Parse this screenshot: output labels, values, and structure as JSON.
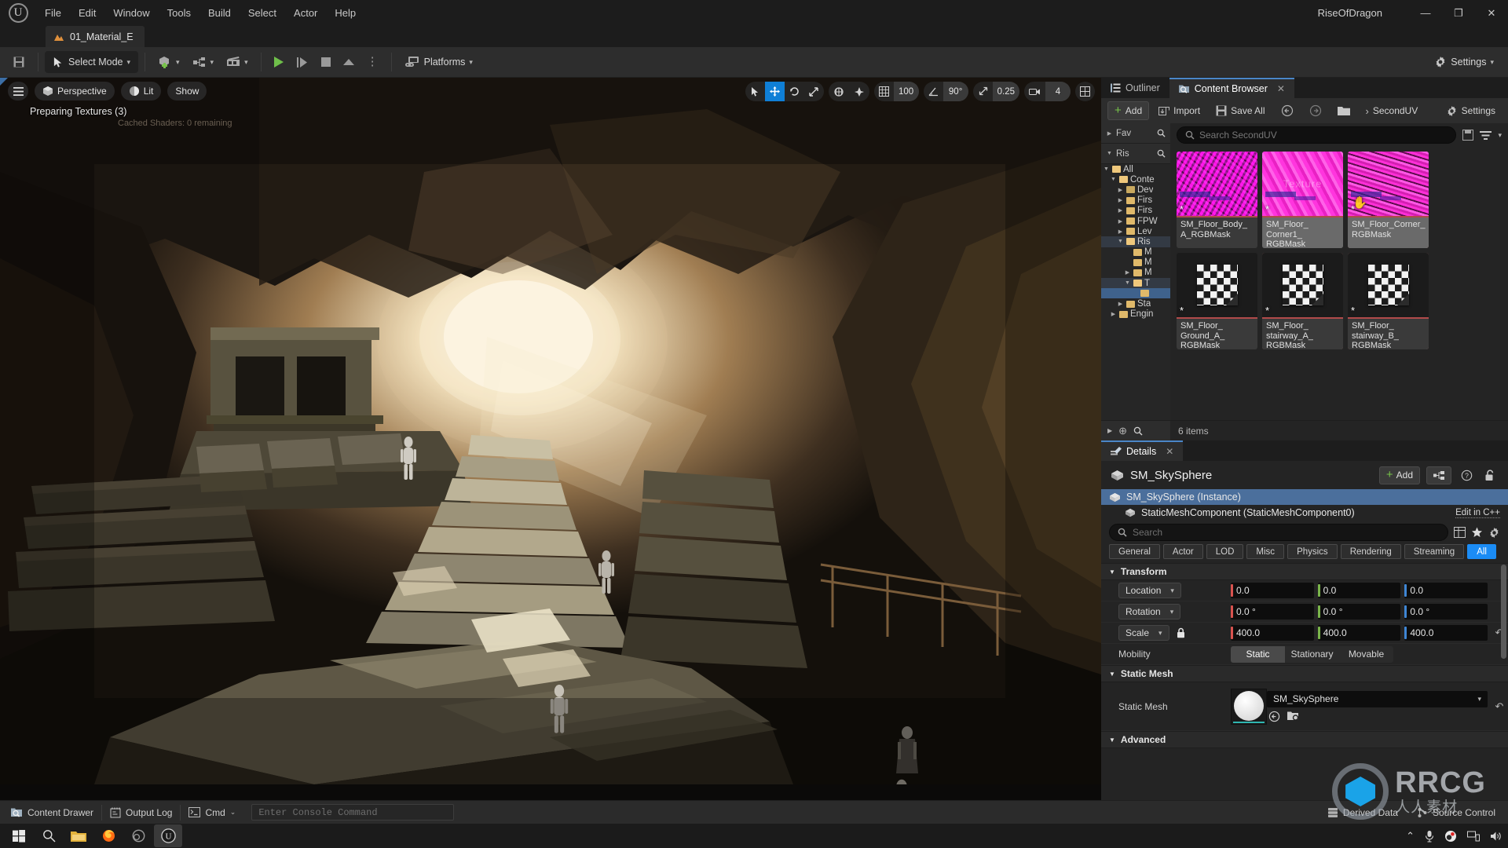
{
  "titlebar": {
    "logo_icon": "unreal-engine-logo",
    "menu": [
      "File",
      "Edit",
      "Window",
      "Tools",
      "Build",
      "Select",
      "Actor",
      "Help"
    ],
    "project_name": "RiseOfDragon",
    "window_controls": {
      "minimize": "—",
      "maximize": "❐",
      "close": "✕"
    }
  },
  "level_tab": {
    "label": "01_Material_E",
    "icon": "level-icon"
  },
  "toolbar": {
    "save_icon": "save-icon",
    "mode_label": "Select Mode",
    "mode_icon": "select-mode-icon",
    "add_icon": "add-actor-icon",
    "blueprint_icon": "blueprints-icon",
    "cinematics_icon": "cinematics-icon",
    "play_icon": "play-icon",
    "skip_icon": "skip-icon",
    "stop_icon": "stop-icon",
    "eject_icon": "eject-icon",
    "more_icon": "kebab-icon",
    "platforms_label": "Platforms",
    "platforms_icon": "platforms-icon",
    "settings_label": "Settings",
    "settings_icon": "gear-icon"
  },
  "viewport": {
    "menu_icon": "hamburger-icon",
    "perspective_label": "Perspective",
    "perspective_icon": "cube-icon",
    "lit_label": "Lit",
    "lit_icon": "lighting-icon",
    "show_label": "Show",
    "status_text": "Preparing Textures (3)",
    "ghost_text": "Cached Shaders: 0 remaining",
    "transform_tools": [
      {
        "name": "select-tool",
        "glyph": "➤",
        "active": false
      },
      {
        "name": "move-tool",
        "glyph": "✥",
        "active": true
      },
      {
        "name": "rotate-tool",
        "glyph": "⟳",
        "active": false
      },
      {
        "name": "scale-tool",
        "glyph": "⤡",
        "active": false
      }
    ],
    "coord_tools": [
      {
        "name": "world-space-icon",
        "glyph": "⊕"
      },
      {
        "name": "surface-snap-icon",
        "glyph": "✲"
      }
    ],
    "grid_snap": {
      "icon": "grid-icon",
      "value": "100"
    },
    "angle_snap": {
      "icon": "angle-icon",
      "value": "90°"
    },
    "scale_snap": {
      "icon": "scale-snap-icon",
      "value": "0.25"
    },
    "camera_speed": {
      "icon": "camera-icon",
      "value": "4"
    },
    "layout_icon": "viewport-layout-icon"
  },
  "content_browser": {
    "tabs": [
      {
        "label": "Outliner",
        "icon": "outliner-icon",
        "active": false
      },
      {
        "label": "Content Browser",
        "icon": "content-browser-icon",
        "active": true,
        "close": "✕"
      }
    ],
    "toolbar": {
      "add_label": "Add",
      "import_label": "Import",
      "import_icon": "import-icon",
      "save_all_label": "Save All",
      "save_all_icon": "save-icon",
      "back_icon": "back-arrow-icon",
      "forward_icon": "forward-arrow-icon",
      "folder_icon": "folder-icon",
      "breadcrumb_sep": "›",
      "breadcrumb": "SecondUV",
      "settings_label": "Settings",
      "settings_icon": "gear-icon"
    },
    "search": {
      "placeholder": "Search SecondUV",
      "icon": "search-icon"
    },
    "search_tools": {
      "save_search_icon": "save-search-icon",
      "filter_icon": "filter-icon",
      "chevron_icon": "chevron-down-icon"
    },
    "sources": {
      "favorites_label": "Fav",
      "project_label": "Ris",
      "search_icon": "search-icon",
      "tree": [
        {
          "label": "All",
          "depth": 0,
          "twisty": "▼",
          "state": "normal",
          "folder": "open"
        },
        {
          "label": "Conte",
          "depth": 1,
          "twisty": "▼",
          "state": "normal",
          "folder": "open"
        },
        {
          "label": "Dev",
          "depth": 2,
          "twisty": "▶",
          "state": "normal",
          "folder": "dev"
        },
        {
          "label": "Firs",
          "depth": 2,
          "twisty": "▶",
          "state": "normal",
          "folder": "closed"
        },
        {
          "label": "Firs",
          "depth": 2,
          "twisty": "▶",
          "state": "normal",
          "folder": "closed"
        },
        {
          "label": "FPW",
          "depth": 2,
          "twisty": "▶",
          "state": "normal",
          "folder": "closed"
        },
        {
          "label": "Lev",
          "depth": 2,
          "twisty": "▶",
          "state": "normal",
          "folder": "closed"
        },
        {
          "label": "Ris",
          "depth": 2,
          "twisty": "▼",
          "state": "highlight",
          "folder": "open"
        },
        {
          "label": "M",
          "depth": 3,
          "twisty": "",
          "state": "normal",
          "folder": "closed"
        },
        {
          "label": "M",
          "depth": 3,
          "twisty": "",
          "state": "normal",
          "folder": "closed"
        },
        {
          "label": "M",
          "depth": 3,
          "twisty": "▶",
          "state": "normal",
          "folder": "closed"
        },
        {
          "label": "T",
          "depth": 3,
          "twisty": "▼",
          "state": "highlight",
          "folder": "open"
        },
        {
          "label": "",
          "depth": 4,
          "twisty": "",
          "state": "selected",
          "folder": "closed"
        },
        {
          "label": "Sta",
          "depth": 2,
          "twisty": "▶",
          "state": "normal",
          "folder": "closed"
        },
        {
          "label": "Engin",
          "depth": 1,
          "twisty": "▶",
          "state": "normal",
          "folder": "closed"
        }
      ],
      "footer": {
        "expand_icon": "▶",
        "zoom_in_icon": "⊕",
        "search_icon": "search-icon"
      }
    },
    "assets": [
      {
        "name": "SM_Floor_Body_A_RGBMask",
        "thumb": "noise1",
        "modified": "*",
        "selected": false,
        "outlined": false,
        "watermark": ""
      },
      {
        "name": "SM_Floor_Corner1_RGBMask",
        "thumb": "noise2",
        "modified": "*",
        "selected": true,
        "outlined": false,
        "watermark": "Texture"
      },
      {
        "name": "SM_Floor_Corner_RGBMask",
        "thumb": "noise3",
        "modified": "*",
        "selected": true,
        "outlined": true,
        "watermark": ""
      },
      {
        "name": "SM_Floor_Ground_A_RGBMask",
        "thumb": "checker",
        "modified": "*",
        "selected": false,
        "outlined": false,
        "watermark": ""
      },
      {
        "name": "SM_Floor_stairway_A_RGBMask",
        "thumb": "checker",
        "modified": "*",
        "selected": false,
        "outlined": true,
        "watermark": ""
      },
      {
        "name": "SM_Floor_stairway_B_RGBMask",
        "thumb": "checker",
        "modified": "*",
        "selected": false,
        "outlined": true,
        "watermark": ""
      }
    ],
    "item_count": "6 items",
    "cursor_icon": "hand-cursor"
  },
  "details": {
    "tab": {
      "label": "Details",
      "icon": "details-icon",
      "close": "✕"
    },
    "actor_name": "SM_SkySphere",
    "actor_icon": "static-mesh-icon",
    "add_label": "Add",
    "header_icons": [
      "component-graph-icon",
      "help-icon",
      "unlock-icon"
    ],
    "outline": [
      {
        "label": "SM_SkySphere (Instance)",
        "icon": "static-mesh-icon",
        "selected": true,
        "depth": 0,
        "action": ""
      },
      {
        "label": "StaticMeshComponent (StaticMeshComponent0)",
        "icon": "static-mesh-icon",
        "selected": false,
        "depth": 1,
        "action": "Edit in C++"
      }
    ],
    "search": {
      "placeholder": "Search",
      "icon": "search-icon"
    },
    "search_tools": [
      "column-layout-icon",
      "favorite-star-icon",
      "gear-icon"
    ],
    "filter_chips": [
      {
        "label": "General",
        "active": false
      },
      {
        "label": "Actor",
        "active": false
      },
      {
        "label": "LOD",
        "active": false
      },
      {
        "label": "Misc",
        "active": false
      },
      {
        "label": "Physics",
        "active": false
      },
      {
        "label": "Rendering",
        "active": false
      },
      {
        "label": "Streaming",
        "active": false
      },
      {
        "label": "All",
        "active": true
      }
    ],
    "transform": {
      "section_label": "Transform",
      "rows": [
        {
          "label": "Location",
          "type": "vector",
          "has_dropdown": true,
          "locked": false,
          "values": [
            "0.0",
            "0.0",
            "0.0"
          ],
          "revert": false
        },
        {
          "label": "Rotation",
          "type": "vector",
          "has_dropdown": true,
          "locked": false,
          "values": [
            "0.0 °",
            "0.0 °",
            "0.0 °"
          ],
          "revert": false
        },
        {
          "label": "Scale",
          "type": "vector",
          "has_dropdown": true,
          "locked": true,
          "lock_icon": "lock-icon",
          "values": [
            "400.0",
            "400.0",
            "400.0"
          ],
          "revert": true
        }
      ],
      "mobility": {
        "label": "Mobility",
        "options": [
          "Static",
          "Stationary",
          "Movable"
        ],
        "selected": "Static"
      }
    },
    "static_mesh": {
      "section_label": "Static Mesh",
      "row_label": "Static Mesh",
      "value": "SM_SkySphere",
      "dropdown_icon": "chevron-down-icon",
      "browse_icon": "browse-to-asset-icon",
      "find_icon": "find-in-content-browser-icon",
      "revert_icon": "revert-icon"
    },
    "advanced_label": "Advanced"
  },
  "statusbar": {
    "content_drawer": {
      "label": "Content Drawer",
      "icon": "content-drawer-icon"
    },
    "output_log": {
      "label": "Output Log",
      "icon": "output-log-icon"
    },
    "cmd": {
      "label": "Cmd",
      "icon": "cmd-icon",
      "caret": "⌄"
    },
    "console": {
      "placeholder": "Enter Console Command"
    },
    "derived_data": {
      "label": "Derived Data",
      "icon": "derived-data-icon"
    },
    "source_control": {
      "label": "Source Control",
      "icon": "source-control-icon"
    }
  },
  "taskbar": {
    "items": [
      {
        "name": "start-button",
        "glyph": "⊞",
        "active": false
      },
      {
        "name": "search-icon",
        "glyph": "⚲",
        "active": false
      },
      {
        "name": "file-explorer-icon",
        "glyph": "▭",
        "active": false
      },
      {
        "name": "firefox-icon",
        "glyph": "●",
        "active": false
      },
      {
        "name": "obs-icon",
        "glyph": "◎",
        "active": false
      },
      {
        "name": "unreal-editor-icon",
        "glyph": "Ⓤ",
        "active": true
      }
    ],
    "tray": [
      {
        "name": "show-hidden-icons",
        "glyph": "⌃"
      },
      {
        "name": "microphone-icon",
        "glyph": "ᵜ"
      },
      {
        "name": "obs-tray-icon",
        "glyph": "◎"
      },
      {
        "name": "network-icon",
        "glyph": "▣"
      },
      {
        "name": "volume-icon",
        "glyph": "◂"
      }
    ]
  },
  "watermark": {
    "top": "RRCG",
    "bottom": "人人素材"
  }
}
